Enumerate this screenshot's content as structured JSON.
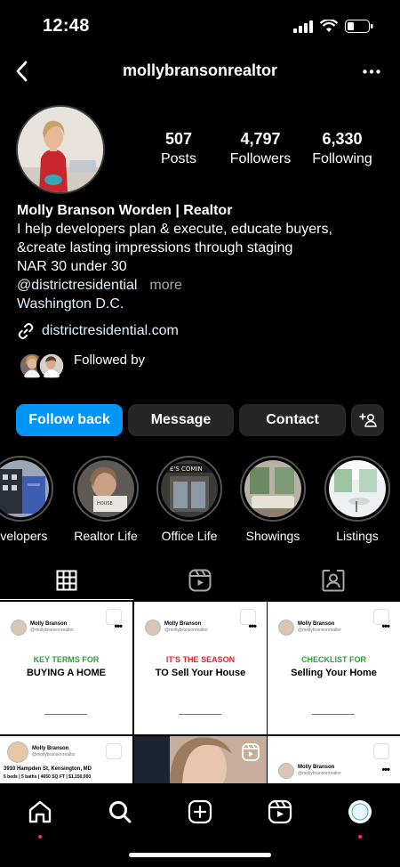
{
  "status": {
    "time": "12:48"
  },
  "header": {
    "username": "mollybransonrealtor"
  },
  "stats": [
    {
      "value": "507",
      "label": "Posts"
    },
    {
      "value": "4,797",
      "label": "Followers"
    },
    {
      "value": "6,330",
      "label": "Following"
    }
  ],
  "bio": {
    "name": "Molly Branson Worden | Realtor",
    "line1": "I help developers plan & execute, educate buyers,",
    "line2": "&create lasting impressions through staging",
    "line3": "NAR 30 under 30",
    "mention": "@districtresidential",
    "more": "more",
    "location": "Washington D.C.",
    "url": "districtresidential.com",
    "followed_by": "Followed by"
  },
  "buttons": {
    "follow_back": "Follow back",
    "message": "Message",
    "contact": "Contact"
  },
  "highlights": [
    {
      "label": "evelopers"
    },
    {
      "label": "Realtor Life"
    },
    {
      "label": "Office Life"
    },
    {
      "label": "Showings"
    },
    {
      "label": "Listings"
    }
  ],
  "posts": [
    {
      "name": "Molly Branson",
      "handle": "@mollybransonrealtor",
      "kicker": "KEY TERMS FOR",
      "kicker_color": "#2e9e3a",
      "title": "BUYING A HOME"
    },
    {
      "name": "Molly Branson",
      "handle": "@mollybransonrealtor",
      "kicker": "IT'S THE SEASON",
      "kicker_color": "#d9262c",
      "title": "TO Sell Your House"
    },
    {
      "name": "Molly Branson",
      "handle": "@mollybransonrealtor",
      "kicker": "CHECKLIST FOR",
      "kicker_color": "#2e9e3a",
      "title": "Selling Your Home"
    },
    {
      "name": "Molly Branson",
      "handle": "@mollybransonrealtor",
      "address": "3910 Hampden St, Kensington, MD",
      "details": "5 beds | 5 baths | 4650 SQ FT | $1,150,000"
    },
    {
      "name": "Molly Branson",
      "handle": "@mollybransonrealtor"
    }
  ],
  "icons": {
    "back": "chevron-left-icon",
    "more": "ellipsis-icon",
    "link": "link-icon",
    "add_user": "add-person-icon",
    "grid": "grid-icon",
    "reels": "reels-icon",
    "tagged": "tagged-person-icon",
    "home": "home-icon",
    "search": "search-icon",
    "create": "plus-square-icon",
    "reels_nav": "reels-icon",
    "profile": "profile-avatar-icon"
  },
  "colors": {
    "primary": "#0095f6",
    "secondary_button": "#262626",
    "link": "#e0f1ff",
    "notification_dot": "#ff3040"
  }
}
